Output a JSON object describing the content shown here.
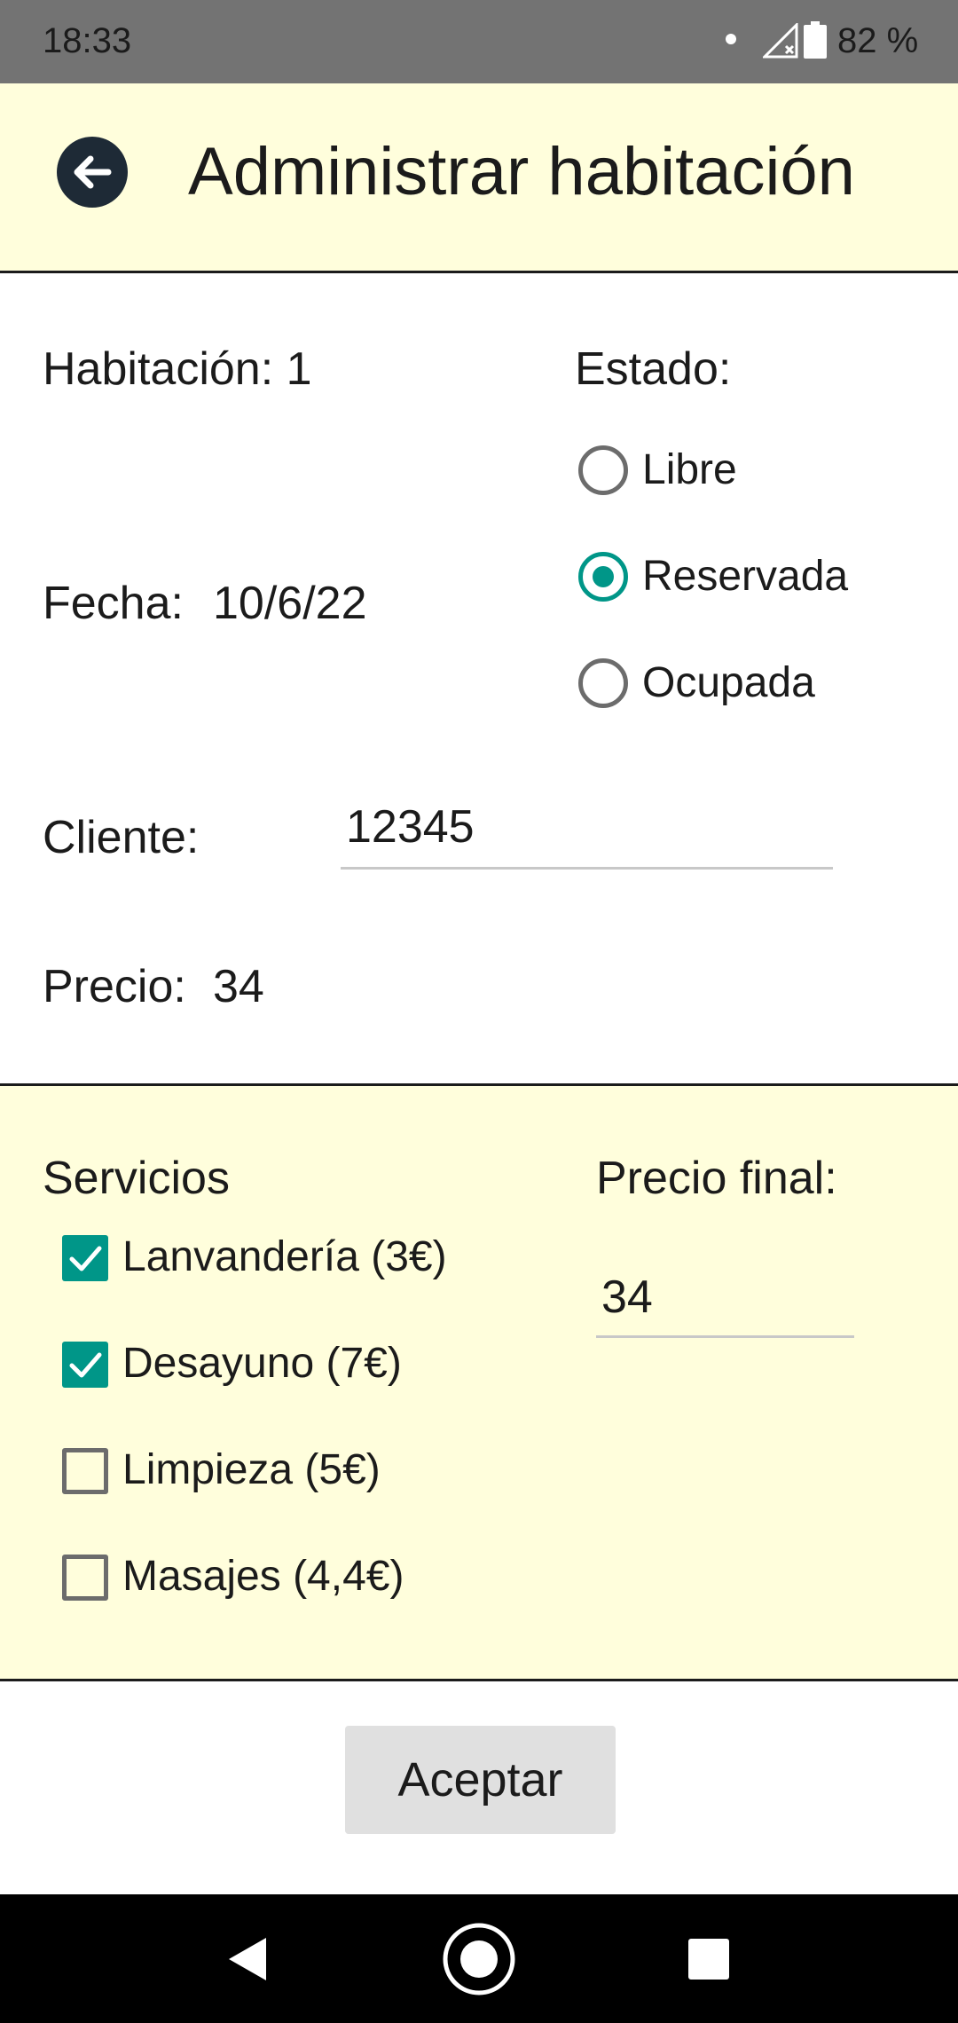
{
  "status_bar": {
    "time": "18:33",
    "battery": "82 %"
  },
  "header": {
    "title": "Administrar habitación"
  },
  "room": {
    "habitacion_label": "Habitación: 1",
    "fecha_label": "Fecha:",
    "fecha_value": "10/6/22",
    "cliente_label": "Cliente:",
    "cliente_value": "12345",
    "precio_label": "Precio:",
    "precio_value": "34"
  },
  "estado": {
    "label": "Estado:",
    "options": [
      {
        "label": "Libre",
        "selected": false
      },
      {
        "label": "Reservada",
        "selected": true
      },
      {
        "label": "Ocupada",
        "selected": false
      }
    ]
  },
  "services": {
    "title": "Servicios",
    "items": [
      {
        "label": "Lanvandería (3€)",
        "checked": true
      },
      {
        "label": "Desayuno (7€)",
        "checked": true
      },
      {
        "label": "Limpieza (5€)",
        "checked": false
      },
      {
        "label": "Masajes (4,4€)",
        "checked": false
      }
    ],
    "final_price_label": "Precio final:",
    "final_price_value": "34"
  },
  "actions": {
    "accept_label": "Aceptar"
  },
  "colors": {
    "accent": "#009688",
    "panel_bg": "#fffedc",
    "status_bar": "#737373"
  }
}
